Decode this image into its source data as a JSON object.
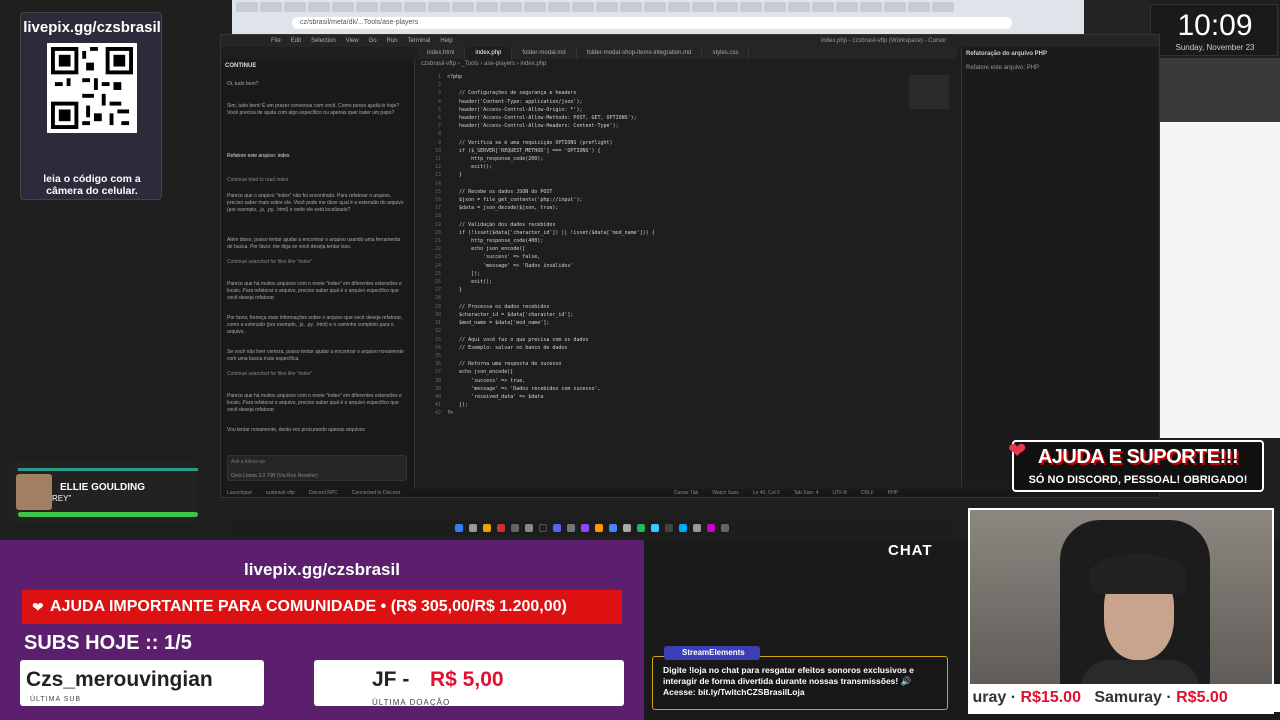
{
  "qr": {
    "url": "livepix.gg/czsbrasil",
    "caption": "leia o código com a câmera do celular."
  },
  "music": {
    "title": "ELLIE GOULDING",
    "artist": "REY\""
  },
  "clock": {
    "time": "10:09",
    "date": "Sunday, November 23"
  },
  "browser": {
    "url": "cz/sbrasil/meta/dk/...Tools/ase-players"
  },
  "ide": {
    "menu": [
      "File",
      "Edit",
      "Selection",
      "View",
      "Go",
      "Run",
      "Terminal",
      "Help"
    ],
    "title": "index.php - czsbrasil-vftp (Workspace) - Cursor",
    "tabs": [
      "index.html",
      "index.php",
      "folder-modal.md",
      "folder-modal-shop-items-integration.md",
      "styles.css"
    ],
    "active_tab": 1,
    "breadcrumb": "czsbrasil-vftp › _Tools › ase-players › index.php",
    "chat_title": "CONTINUE",
    "chat_lines": [
      "Oi, tudo bom?",
      "Sim, tudo bem! É um prazer conversar com você. Como posso ajudá-lo hoje? Você precisa de ajuda com algo específico ou apenas quer bater um papo?",
      "Refatore este arquivo: index",
      "Continue tried to read index",
      "Parece que o arquivo \"index\" não foi encontrado. Para refatorar o arquivo, preciso saber mais sobre ele. Você pode me dizer qual é a extensão do arquivo (por exemplo, .js, .py, .html) e onde ele está localizado?",
      "Além disso, posso tentar ajudar a encontrar o arquivo usando uma ferramenta de busca. Por favor, me diga se você deseja tentar isso.",
      "Continue searched for files like \"index\"",
      "Parece que há muitos arquivos com o nome \"index\" em diferentes extensões e locais. Para refatorar o arquivo, preciso saber qual é o arquivo específico que você deseja refatorar.",
      "Por favor, forneça mais informações sobre o arquivo que você deseja refatorar, como a extensão (por exemplo, .js, .py, .html) e o caminho completo para o arquivo.",
      "Se você não tiver certeza, posso tentar ajudar a encontrar o arquivo novamente com uma busca mais específica.",
      "Continue searched for files like \"index\"",
      "Parece que há muitos arquivos com o nome \"index\" em diferentes extensões e locais. Para refatorar o arquivo, preciso saber qual é o arquivo específico que você deseja refatorar.",
      "Vou tentar novamente, desta vez procurando apenas arquivos"
    ],
    "chat_placeholder": "Ask a follow-up",
    "chat_model": "Grok Llama 3.3 70B (Via Roo Reseller)",
    "right_title": "Refatoração do arquivo PHP",
    "right_sub": "Refatore este arquivo: PHP",
    "code": "<?php\n\n    // Configurações de segurança e headers\n    header('Content-Type: application/json');\n    header('Access-Control-Allow-Origin: *');\n    header('Access-Control-Allow-Methods: POST, GET, OPTIONS');\n    header('Access-Control-Allow-Headers: Content-Type');\n\n    // Verifica se é uma requisição OPTIONS (preflight)\n    if ($_SERVER['REQUEST_METHOD'] === 'OPTIONS') {\n        http_response_code(200);\n        exit();\n    }\n\n    // Recebe os dados JSON do POST\n    $json = file_get_contents('php://input');\n    $data = json_decode($json, true);\n\n    // Validação dos dados recebidos\n    if (!isset($data['character_id']) || !isset($data['mod_name'])) {\n        http_response_code(400);\n        echo json_encode([\n            'success' => false,\n            'message' => 'Dados inválidos'\n        ]);\n        exit();\n    }\n\n    // Processa os dados recebidos\n    $character_id = $data['character_id'];\n    $mod_name = $data['mod_name'];\n\n    // Aqui você faz o que precisa com os dados\n    // Exemplo: salvar no banco de dados\n\n    // Retorna uma resposta de sucesso\n    echo json_encode([\n        'success' => true,\n        'message' => 'Dados recebidos com sucesso',\n        'received_data' => $data\n    ]);\n?>",
    "status": [
      "Launchpad",
      "czsbrasil-vftp",
      "Discord RPC",
      "Connected to Discord",
      "Cursor Tab",
      "Watch Sass",
      "Ln 40, Col 5",
      "Tab Size: 4",
      "UTF-8",
      "CRLF",
      "PHP"
    ]
  },
  "ajuda": {
    "title": "AJUDA E SUPORTE!!!",
    "sub": "SÓ NO DISCORD, PESSOAL! OBRIGADO!"
  },
  "stream": {
    "livepix": "livepix.gg/czsbrasil",
    "goal": "AJUDA IMPORTANTE PARA COMUNIDADE  •  (R$ 305,00/R$ 1.200,00)",
    "subs": "SUBS HOJE :: 1/5",
    "last_sub": "Czs_merouvingian",
    "last_sub_label": "ÚLTIMA SUB",
    "last_don_who": "JF -",
    "last_don_val": "R$ 5,00",
    "last_don_label": "ÚLTIMA DOAÇÃO",
    "chat_header": "CHAT",
    "se_badge": "StreamElements",
    "se_msg": "Digite !loja no chat para resgatar efeitos sonoros exclusivos e interagir de forma divertida durante nossas transmissões! 🔊 Acesse: bit.ly/TwitchCZSBrasilLoja",
    "ticker_a_name": "uray",
    "ticker_a_amt": "R$15.00",
    "ticker_b_name": "Samuray",
    "ticker_b_amt": "R$5.00"
  },
  "colors": {
    "purple": "#5b1f6e",
    "red": "#d11",
    "accent": "#e01030"
  }
}
